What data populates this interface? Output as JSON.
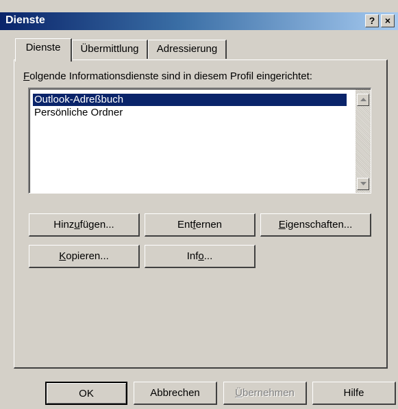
{
  "window": {
    "title": "Dienste",
    "help_glyph": "?",
    "close_glyph": "×"
  },
  "tabs": [
    {
      "label": "Dienste",
      "active": true
    },
    {
      "label": "Übermittlung",
      "active": false
    },
    {
      "label": "Adressierung",
      "active": false
    }
  ],
  "services": {
    "label_prefix": "F",
    "label_rest": "olgende Informationsdienste sind in diesem Profil eingerichtet:",
    "items": [
      {
        "label": "Outlook-Adreßbuch",
        "selected": true
      },
      {
        "label": "Persönliche Ordner",
        "selected": false
      }
    ]
  },
  "actions": {
    "add": {
      "pre": "Hinz",
      "key": "u",
      "post": "fügen..."
    },
    "remove": {
      "pre": "Ent",
      "key": "f",
      "post": "ernen"
    },
    "properties": {
      "pre": "",
      "key": "E",
      "post": "igenschaften..."
    },
    "copy": {
      "pre": "",
      "key": "K",
      "post": "opieren..."
    },
    "info": {
      "pre": "Inf",
      "key": "o",
      "post": "..."
    }
  },
  "footer": {
    "ok": "OK",
    "cancel": "Abbrechen",
    "apply_key": "Ü",
    "apply_rest": "bernehmen",
    "help": "Hilfe"
  },
  "colors": {
    "titlebar_start": "#0a246a",
    "titlebar_end": "#a6caf0",
    "face": "#d4d0c8",
    "selection": "#0a246a"
  }
}
